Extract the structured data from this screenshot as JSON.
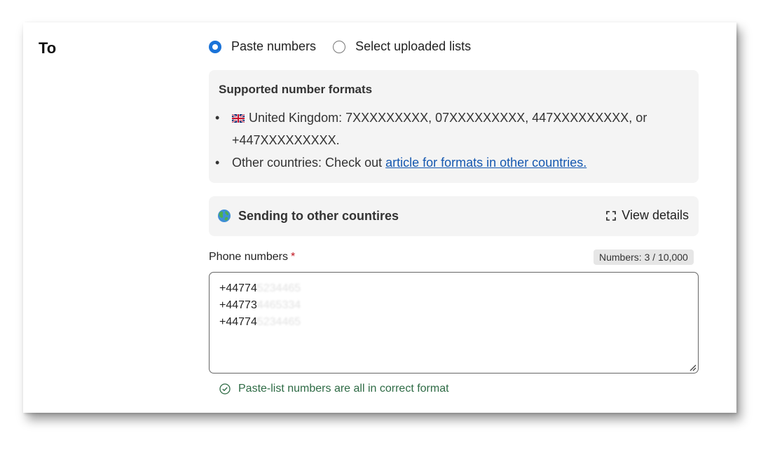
{
  "section": {
    "label": "To"
  },
  "recipient_mode": {
    "options": [
      {
        "label": "Paste numbers",
        "selected": true
      },
      {
        "label": "Select uploaded lists",
        "selected": false
      }
    ]
  },
  "formats": {
    "title": "Supported number formats",
    "uk": {
      "flag_icon": "uk-flag-icon",
      "line1": "United Kingdom: 7XXXXXXXXX, 07XXXXXXXXX, 447XXXXXXXXX, or",
      "line2": "+447XXXXXXXXX."
    },
    "other": {
      "prefix": "Other countries: Check out ",
      "link_text": "article for formats in other countries."
    }
  },
  "sending": {
    "icon": "globe-icon",
    "label": "Sending to other countires",
    "view_details_label": "View details"
  },
  "phone": {
    "label": "Phone numbers",
    "required_mark": "*",
    "count_badge": "Numbers: 3 / 10,000",
    "numbers": [
      {
        "visible": "+44774",
        "hidden": "5234465"
      },
      {
        "visible": "+44773",
        "hidden": "4465334"
      },
      {
        "visible": "+44774",
        "hidden": "5234465"
      }
    ]
  },
  "validation": {
    "message": "Paste-list numbers are all in correct format",
    "color": "#2e6b45"
  },
  "colors": {
    "accent": "#1a73d8",
    "link": "#1558b0",
    "required": "#c0141f",
    "panel_bg": "#f4f4f4"
  }
}
